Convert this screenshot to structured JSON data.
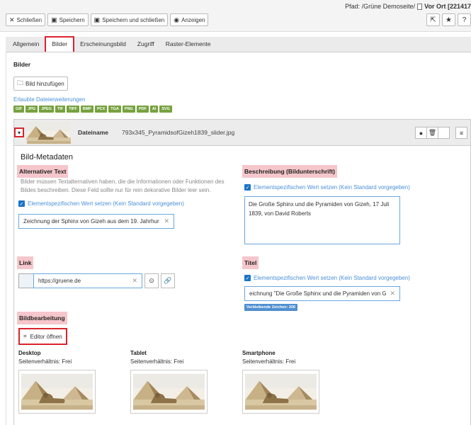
{
  "header": {
    "path_label": "Pfad: /Grüne Demoseite/",
    "path_current": "Vor Ort [221417"
  },
  "toolbar": {
    "close_label": "Schließen",
    "save_label": "Speichern",
    "save_close_label": "Speichern und schließen",
    "view_label": "Anzeigen"
  },
  "tabs": [
    {
      "label": "Allgemein"
    },
    {
      "label": "Bilder"
    },
    {
      "label": "Erscheinungsbild"
    },
    {
      "label": "Zugriff"
    },
    {
      "label": "Raster-Elemente"
    }
  ],
  "images": {
    "title": "Bilder",
    "add_button": "Bild hinzufügen",
    "allowed_label": "Erlaubte Dateierweiterungen",
    "extensions": [
      "GIF",
      "JPG",
      "JPEG",
      "TIF",
      "TIFF",
      "BMP",
      "PCX",
      "TGA",
      "PNG",
      "PDF",
      "AI",
      "SVG"
    ]
  },
  "image_item": {
    "filename_label": "Dateiname",
    "filename": "793x345_PyramidsofGizeh1839_slider.jpg",
    "metadata_title": "Bild-Metadaten",
    "alt": {
      "label": "Alternativer Text",
      "help": "Bilder müssen Textalternativen haben, die die Informationen oder Funktionen des Bildes beschreiben. Diese Feld sollte nur für rein dekorative Bilder leer sein.",
      "checkbox_label": "Elementspezifischen Wert setzen (Kein Standard vorgegeben)",
      "value": "Zeichnung der Sphinx von Gizeh aus dem 19. Jahrhur"
    },
    "description": {
      "label": "Beschreibung (Bildunterschrift)",
      "checkbox_label": "Elementspezifischen Wert setzen (Kein Standard vorgegeben)",
      "value": "Die Große Sphinx und die Pyramiden von Gizeh, 17 Juli 1839, von David Roberts"
    },
    "link": {
      "label": "Link",
      "value": "https://gruene.de"
    },
    "title_field": {
      "label": "Titel",
      "checkbox_label": "Elementspezifischen Wert setzen (Kein Standard vorgegeben)",
      "value": "eichnung \"Die Große Sphinx und die Pyramiden von G",
      "remaining": "Verbleibende Zeichen: 200"
    },
    "editing": {
      "label": "Bildbearbeitung",
      "editor_button": "Editor öffnen"
    },
    "crops": [
      {
        "name": "Desktop",
        "ratio": "Seitenverhältnis: Frei"
      },
      {
        "name": "Tablet",
        "ratio": "Seitenverhältnis: Frei"
      },
      {
        "name": "Smartphone",
        "ratio": "Seitenverhältnis: Frei"
      }
    ]
  },
  "colors": {
    "accent_red": "#d9242c",
    "link_blue": "#4a90d9",
    "extension_green": "#76a23f"
  }
}
